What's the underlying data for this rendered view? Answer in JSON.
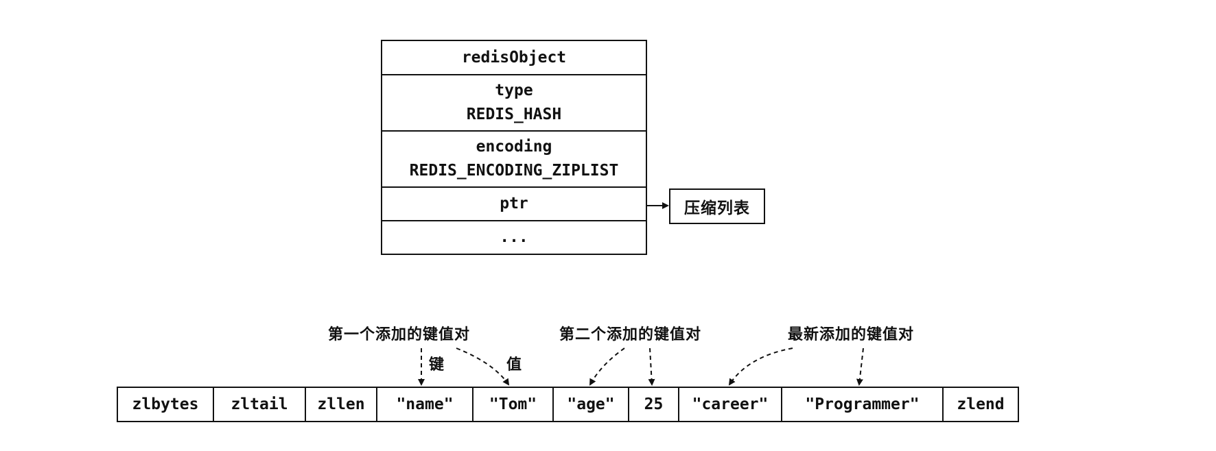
{
  "redis_object": {
    "title": "redisObject",
    "type_label": "type",
    "type_value": "REDIS_HASH",
    "encoding_label": "encoding",
    "encoding_value": "REDIS_ENCODING_ZIPLIST",
    "ptr_label": "ptr",
    "more_label": "..."
  },
  "ptr_target": "压缩列表",
  "ziplist": {
    "cells": [
      "zlbytes",
      "zltail",
      "zllen",
      "\"name\"",
      "\"Tom\"",
      "\"age\"",
      "25",
      "\"career\"",
      "\"Programmer\"",
      "zlend"
    ]
  },
  "annotations": {
    "first_pair": "第一个添加的键值对",
    "second_pair": "第二个添加的键值对",
    "newest_pair": "最新添加的键值对",
    "key_label": "键",
    "value_label": "值"
  }
}
